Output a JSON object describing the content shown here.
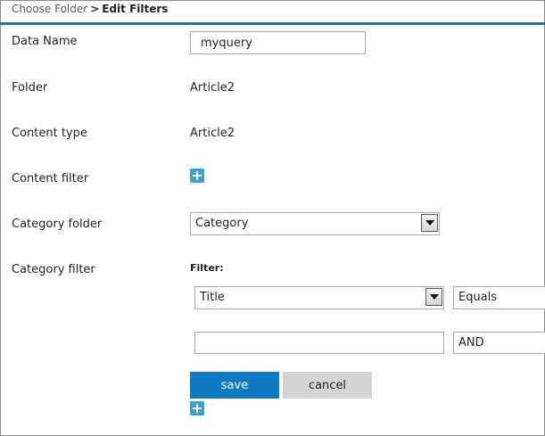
{
  "breadcrumb": {
    "parent": "Choose Folder",
    "separator": ">",
    "current": "Edit Filters"
  },
  "form": {
    "data_name": {
      "label": "Data Name",
      "value": "myquery"
    },
    "folder": {
      "label": "Folder",
      "value": "Article2"
    },
    "content_type": {
      "label": "Content type",
      "value": "Article2"
    },
    "content_filter": {
      "label": "Content filter"
    },
    "category_folder": {
      "label": "Category folder",
      "selected": "Category"
    },
    "category_filter": {
      "label": "Category filter",
      "heading": "Filter:",
      "field_selected": "Title",
      "operator_selected": "Equals",
      "value": "",
      "conjunction_selected": "AND"
    }
  },
  "buttons": {
    "save": "save",
    "cancel": "cancel"
  },
  "colors": {
    "accent": "#1e73a8",
    "save_bg": "#0d7ac3",
    "cancel_bg": "#d4d4d4",
    "plus_icon": "#3aa0d6"
  }
}
